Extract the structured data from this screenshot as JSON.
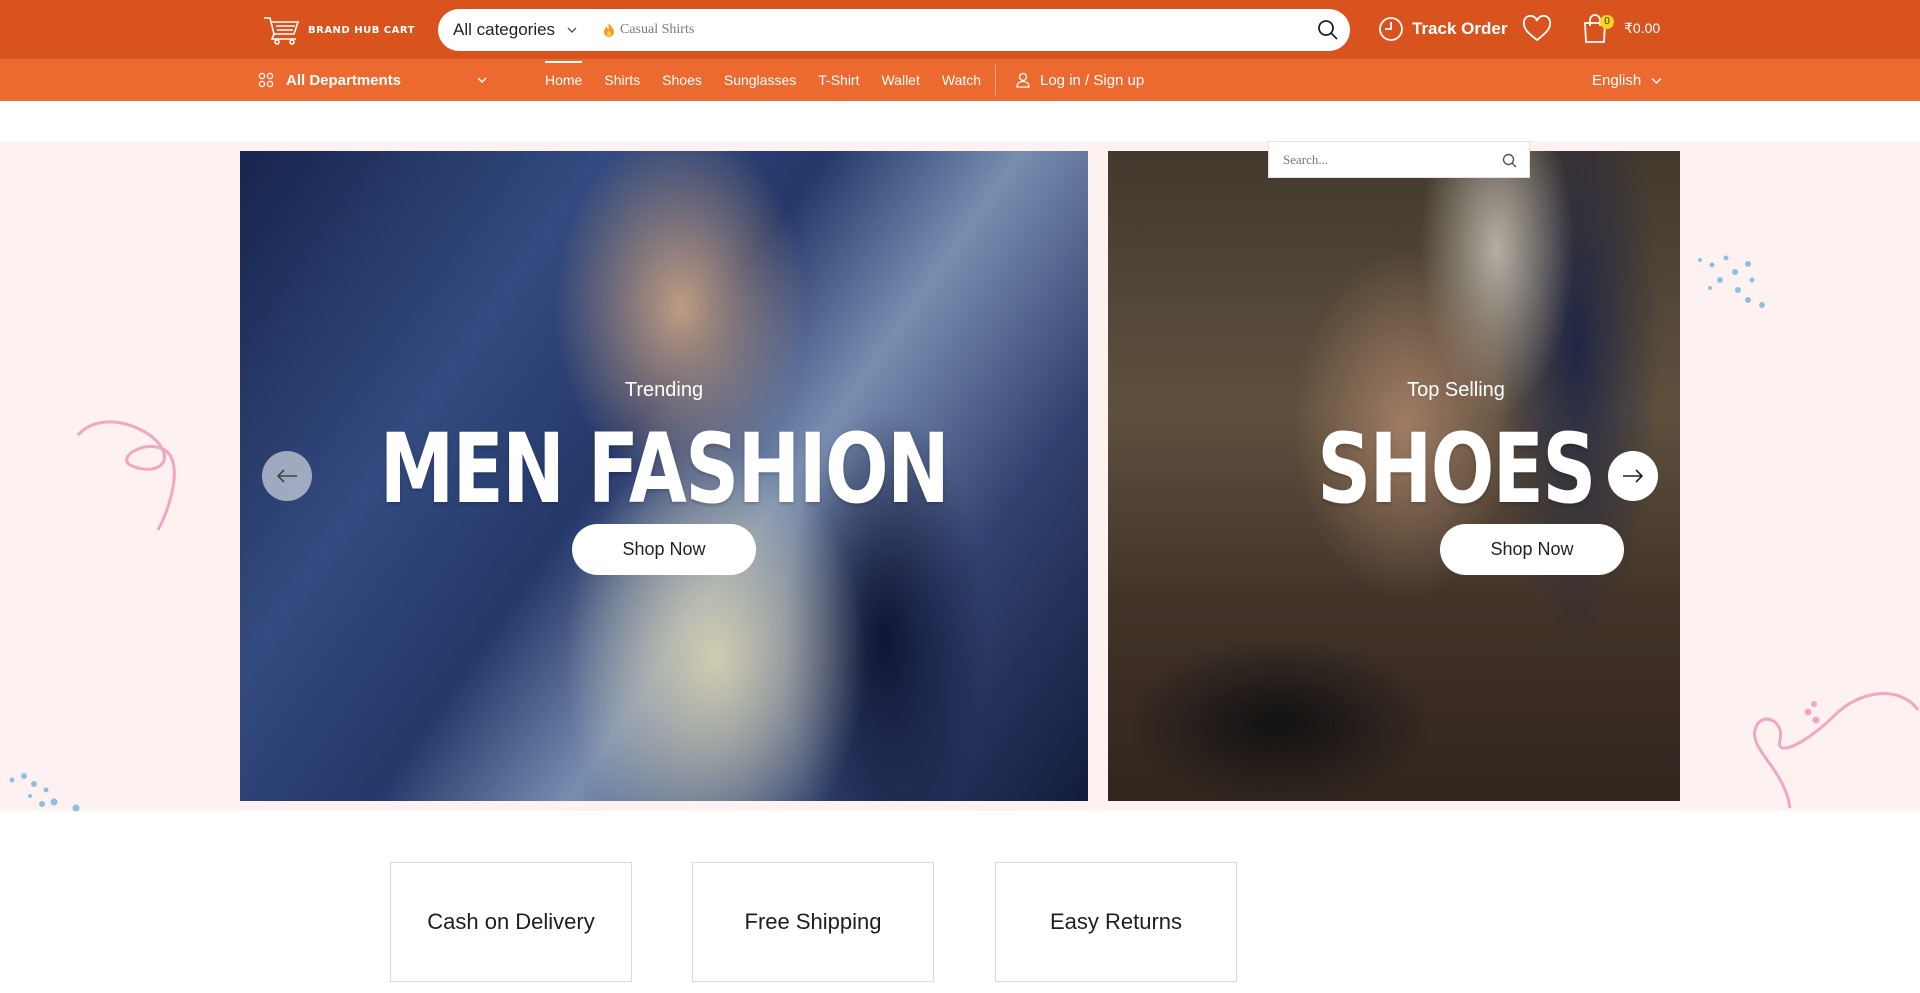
{
  "header": {
    "logo_text": "BRAND HUB CART",
    "category_select": "All categories",
    "search_placeholder": "Casual Shirts",
    "track_order": "Track Order",
    "cart_count": "0",
    "cart_total": "₹0.00"
  },
  "nav": {
    "departments": "All Departments",
    "links": [
      "Home",
      "Shirts",
      "Shoes",
      "Sunglasses",
      "T-Shirt",
      "Wallet",
      "Watch"
    ],
    "active": "Home",
    "login": "Log in / Sign up",
    "language": "English"
  },
  "sidebar_search": {
    "placeholder": "Search..."
  },
  "hero": {
    "slides": [
      {
        "subtitle": "Trending",
        "title": "MEN FASHION",
        "button": "Shop Now"
      },
      {
        "subtitle": "Top Selling",
        "title": "SHOES",
        "button": "Shop Now"
      }
    ]
  },
  "features": [
    "Cash on Delivery",
    "Free Shipping",
    "Easy Returns"
  ],
  "colors": {
    "topbar": "#d9531e",
    "navbar": "#ec6a2f",
    "hero_bg": "#fdf1f1",
    "badge": "#f7d51d"
  },
  "icons": {
    "logo": "cart-icon",
    "category": "chevron-down-icon",
    "search_hint": "flame-icon",
    "search": "search-icon",
    "track": "clock-icon",
    "wishlist": "heart-icon",
    "cart": "shopping-bag-icon",
    "departments": "grid-icon",
    "login": "user-icon",
    "prev": "arrow-left-icon",
    "next": "arrow-right-icon"
  }
}
